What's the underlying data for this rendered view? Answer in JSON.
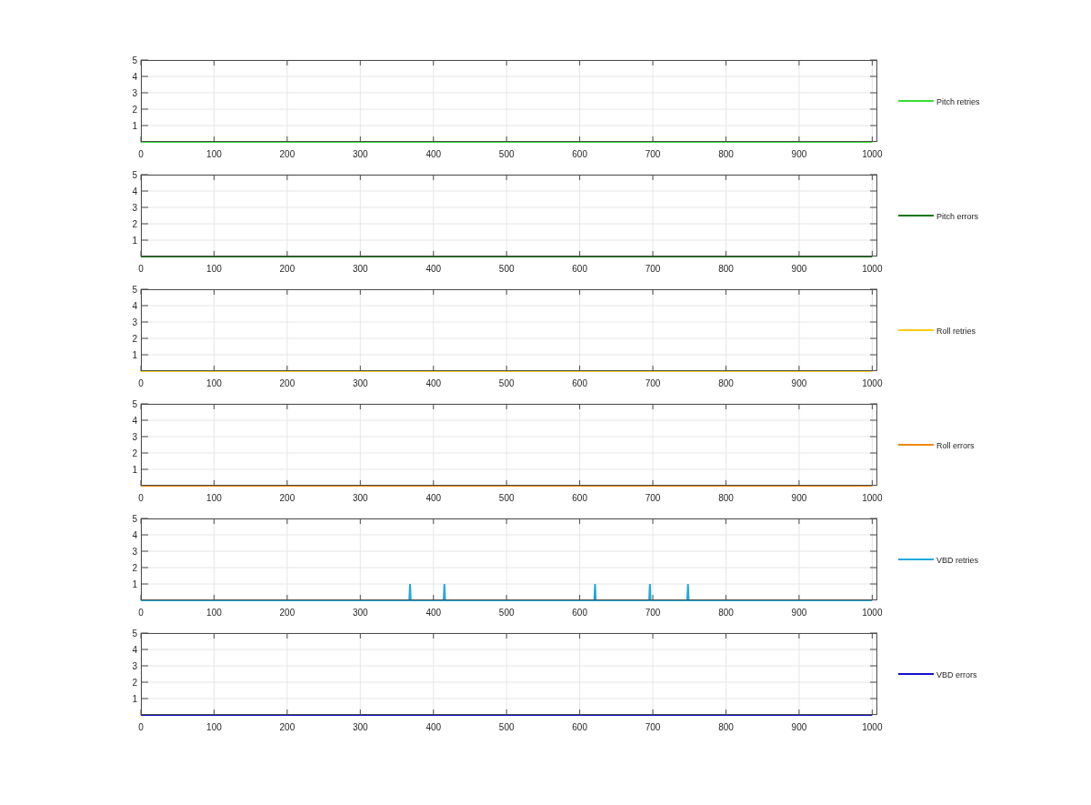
{
  "charts": [
    {
      "chart_data": {
        "type": "line",
        "grid": true,
        "xlim": [
          0,
          1007
        ],
        "ylim": [
          0,
          5
        ],
        "xticks": [
          0,
          100,
          200,
          300,
          400,
          500,
          600,
          700,
          800,
          900,
          1000
        ],
        "yticks": [
          1,
          2,
          3,
          4,
          5
        ],
        "x": [
          0,
          1000
        ],
        "series": [
          {
            "name": "Pitch retries",
            "color": "#33dd33",
            "values": [
              0,
              0
            ]
          }
        ]
      }
    },
    {
      "chart_data": {
        "type": "line",
        "grid": true,
        "xlim": [
          0,
          1007
        ],
        "ylim": [
          0,
          5
        ],
        "xticks": [
          0,
          100,
          200,
          300,
          400,
          500,
          600,
          700,
          800,
          900,
          1000
        ],
        "yticks": [
          1,
          2,
          3,
          4,
          5
        ],
        "x": [
          0,
          1000
        ],
        "series": [
          {
            "name": "Pitch errors",
            "color": "#117711",
            "values": [
              0,
              0
            ]
          }
        ]
      }
    },
    {
      "chart_data": {
        "type": "line",
        "grid": true,
        "xlim": [
          0,
          1007
        ],
        "ylim": [
          0,
          5
        ],
        "xticks": [
          0,
          100,
          200,
          300,
          400,
          500,
          600,
          700,
          800,
          900,
          1000
        ],
        "yticks": [
          1,
          2,
          3,
          4,
          5
        ],
        "x": [
          0,
          1000
        ],
        "series": [
          {
            "name": "Roll retries",
            "color": "#ffcc11",
            "values": [
              0,
              0
            ]
          }
        ]
      }
    },
    {
      "chart_data": {
        "type": "line",
        "grid": true,
        "xlim": [
          0,
          1007
        ],
        "ylim": [
          0,
          5
        ],
        "xticks": [
          0,
          100,
          200,
          300,
          400,
          500,
          600,
          700,
          800,
          900,
          1000
        ],
        "yticks": [
          1,
          2,
          3,
          4,
          5
        ],
        "x": [
          0,
          1000
        ],
        "series": [
          {
            "name": "Roll errors",
            "color": "#ee8811",
            "values": [
              0,
              0
            ]
          }
        ]
      }
    },
    {
      "chart_data": {
        "type": "line",
        "grid": true,
        "xlim": [
          0,
          1007
        ],
        "ylim": [
          0,
          5
        ],
        "xticks": [
          0,
          100,
          200,
          300,
          400,
          500,
          600,
          700,
          800,
          900,
          1000
        ],
        "yticks": [
          1,
          2,
          3,
          4,
          5
        ],
        "x": [
          0,
          367,
          368,
          369,
          414,
          415,
          416,
          620,
          621,
          622,
          695,
          696,
          697,
          747,
          748,
          749,
          1000
        ],
        "series": [
          {
            "name": "VBD retries",
            "color": "#22aadd",
            "values": [
              0,
              0,
              1,
              0,
              0,
              1,
              0,
              0,
              1,
              0,
              0,
              1,
              0,
              0,
              1,
              0,
              0
            ]
          }
        ]
      }
    },
    {
      "chart_data": {
        "type": "line",
        "grid": true,
        "xlim": [
          0,
          1007
        ],
        "ylim": [
          0,
          5
        ],
        "xticks": [
          0,
          100,
          200,
          300,
          400,
          500,
          600,
          700,
          800,
          900,
          1000
        ],
        "yticks": [
          1,
          2,
          3,
          4,
          5
        ],
        "x": [
          0,
          1000
        ],
        "series": [
          {
            "name": "VBD errors",
            "color": "#1111cc",
            "values": [
              0,
              0
            ]
          }
        ]
      }
    }
  ]
}
